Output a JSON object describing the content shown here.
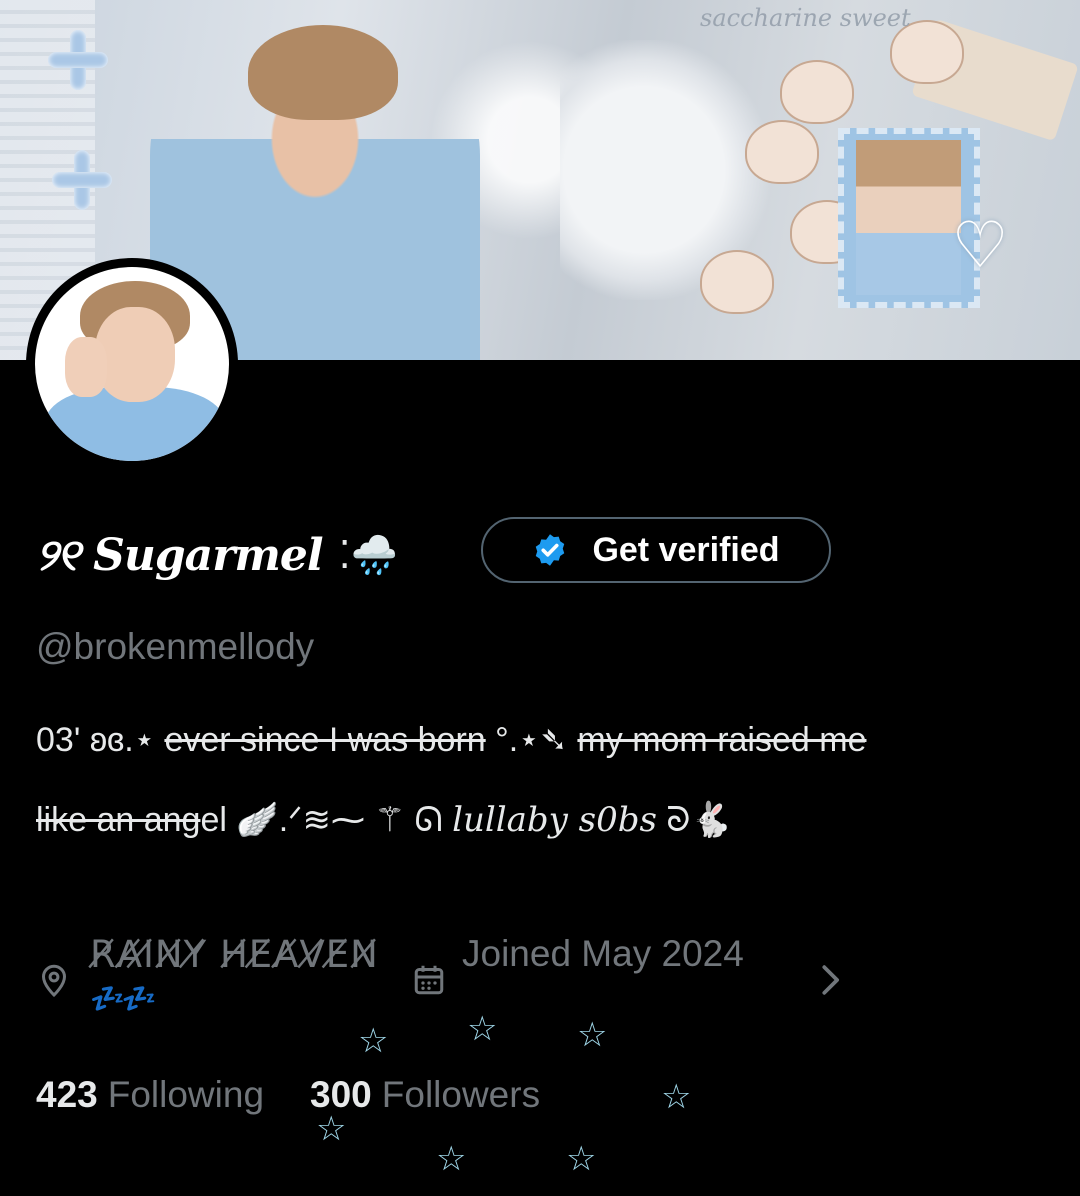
{
  "profile": {
    "display_name": "୨୧ Sugarmel",
    "name_emoji": "⁚🌧️",
    "verify_label": "Get verified",
    "handle": "@brokenmellody",
    "bio": {
      "line1_prefix": "03' ʚɞ.⋆ ",
      "line1_strike_a": "ever since I was born",
      "line1_mid": " °.⋆➴ ",
      "line1_strike_b": "my mom raised me",
      "line2_strike": "like an ang",
      "line2_tail": "el 🪽.ᐟ≋⁓ ⚚ ᘏ ",
      "line2_script": "lullaby s0bs",
      "line2_end": " ᘐ🐇"
    },
    "location": "R̸A̸I̸N̸Y̸ H̸E̸A̸V̸E̸N̸",
    "location_emoji": "💤💤",
    "joined": "Joined May 2024",
    "following_count": "423",
    "following_label": "Following",
    "followers_count": "300",
    "followers_label": "Followers"
  },
  "banner": {
    "watermark": "saccharine sweet",
    "clef": "♡"
  },
  "decor": {
    "star": "☆"
  },
  "colors": {
    "background": "#000000",
    "primary_text": "#e7e9ea",
    "secondary_text": "#71767b",
    "badge_blue": "#1d9bf0",
    "star_color": "#9fd6e8"
  },
  "icons": [
    "location-pin-icon",
    "calendar-icon",
    "chevron-right-icon",
    "verified-badge-icon"
  ]
}
